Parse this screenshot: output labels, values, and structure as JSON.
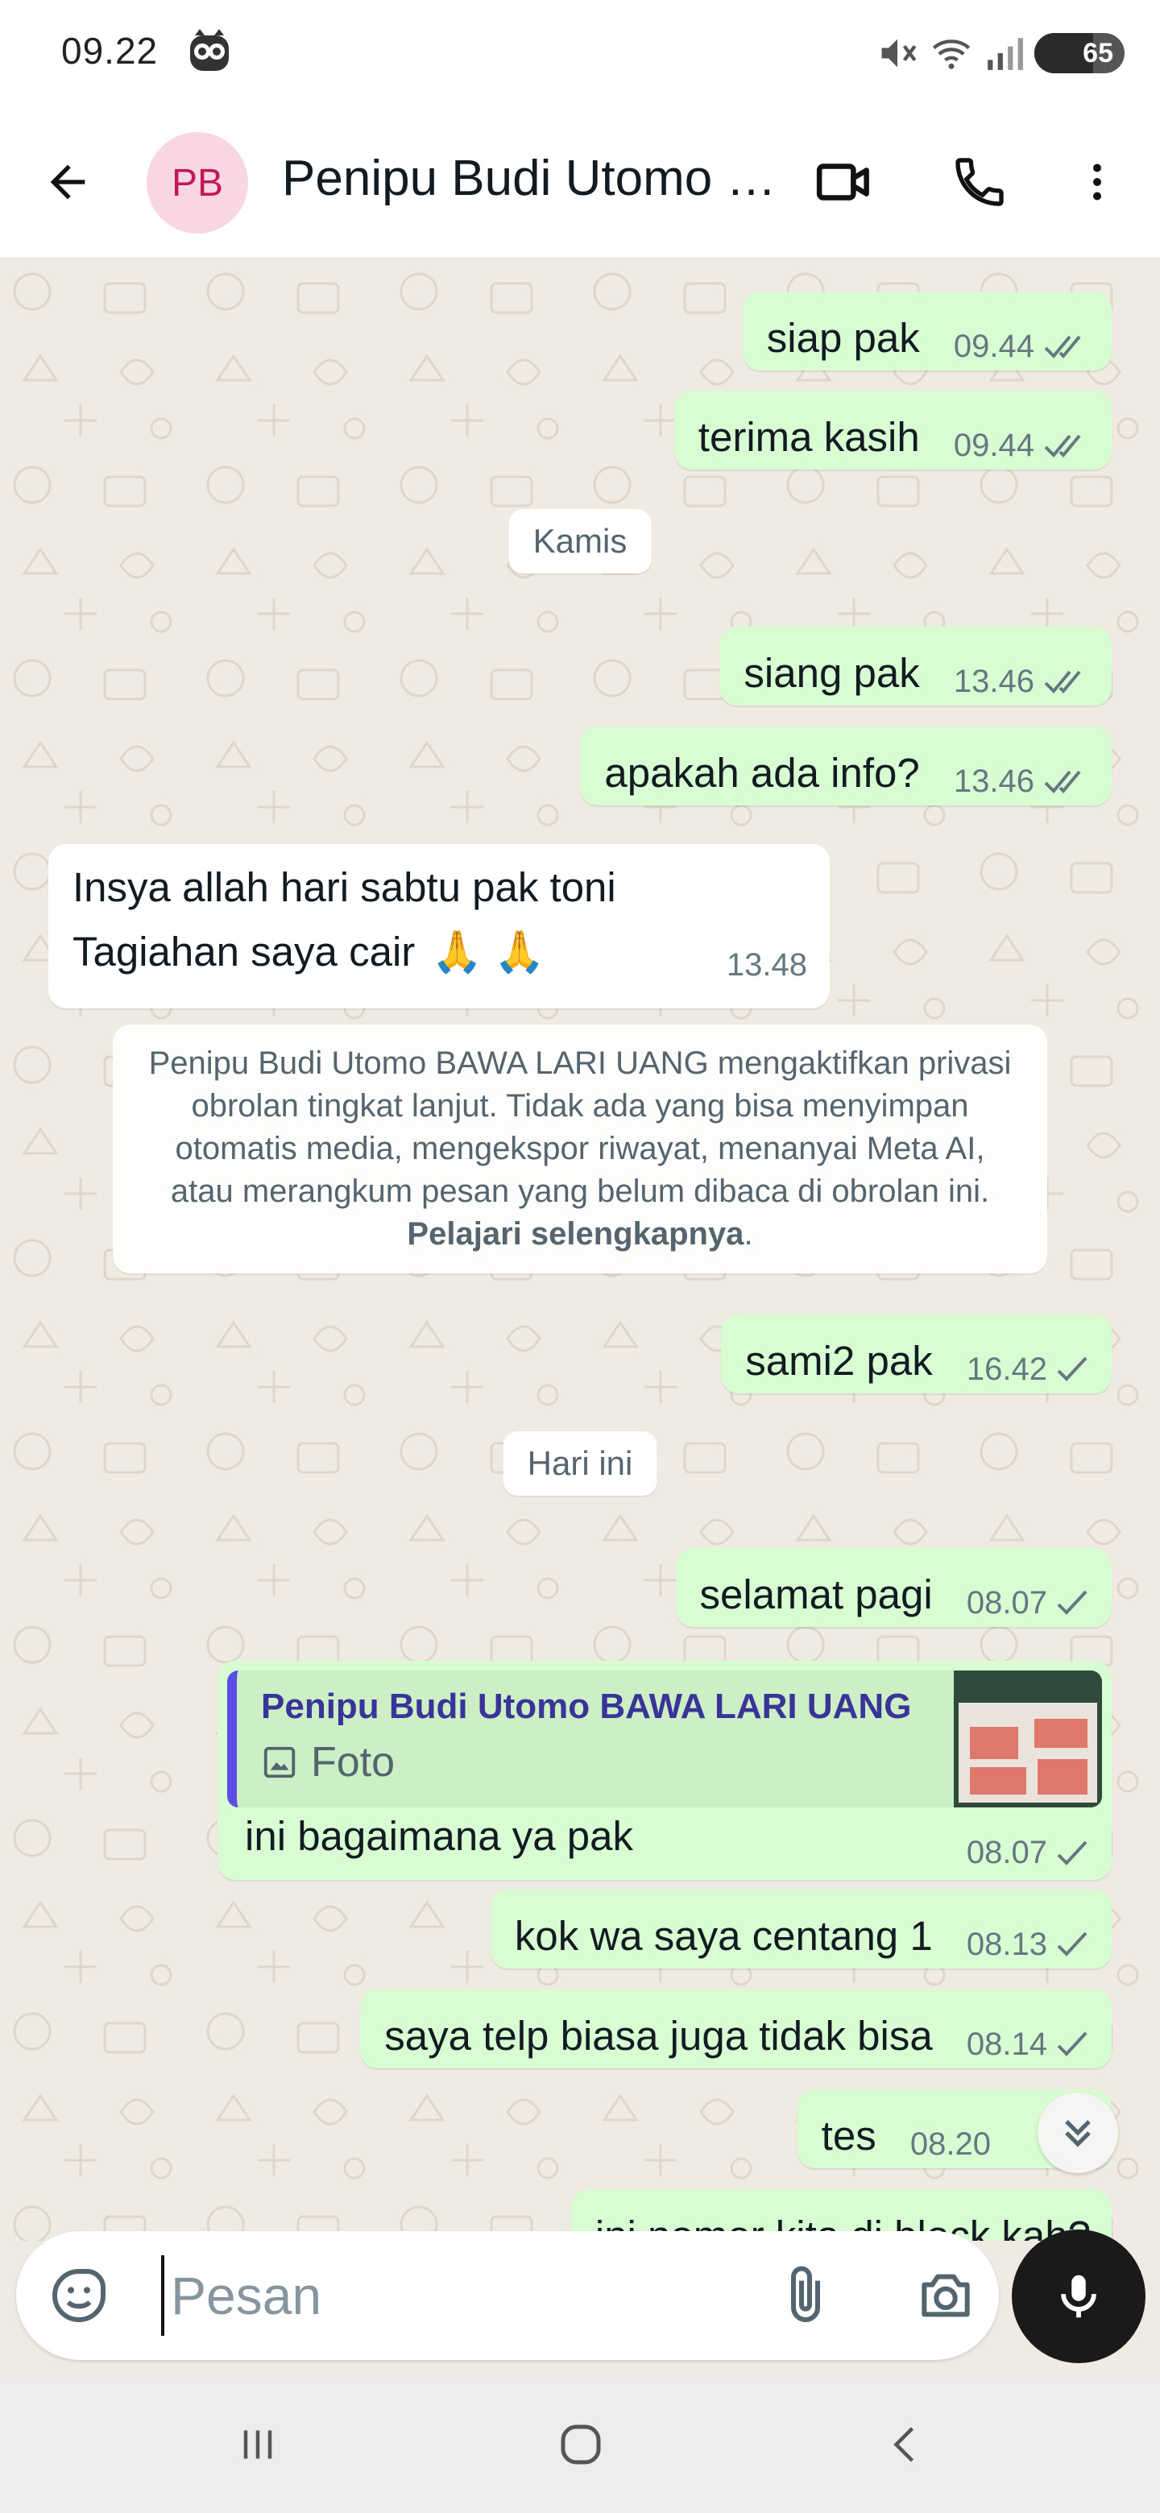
{
  "status_bar": {
    "time": "09.22",
    "battery": "65"
  },
  "header": {
    "avatar_initials": "PB",
    "contact_name": "Penipu Budi Utomo BAWA LARI UANG",
    "icons": [
      "back-arrow-icon",
      "video-call-icon",
      "phone-icon",
      "more-vert-icon"
    ]
  },
  "messages": [
    {
      "dir": "out",
      "text": "siap pak",
      "time": "09.44",
      "status": "read"
    },
    {
      "dir": "out",
      "text": "terima kasih",
      "time": "09.44",
      "status": "read"
    },
    {
      "type": "date",
      "text": "Kamis"
    },
    {
      "dir": "out",
      "text": "siang pak",
      "time": "13.46",
      "status": "read"
    },
    {
      "dir": "out",
      "text": "apakah ada info?",
      "time": "13.46",
      "status": "read"
    },
    {
      "dir": "in",
      "line1": "Insya allah hari sabtu pak toni",
      "line2": "Tagiahan saya cair",
      "emoji": "🙏 🙏",
      "time": "13.48"
    },
    {
      "type": "system",
      "text": "Penipu Budi Utomo BAWA LARI UANG mengaktifkan privasi obrolan tingkat lanjut. Tidak ada yang bisa menyimpan otomatis media, mengekspor riwayat, menanyai Meta AI, atau merangkum pesan yang belum dibaca di obrolan ini.",
      "link": "Pelajari selengkapnya"
    },
    {
      "dir": "out",
      "text": "sami2 pak",
      "time": "16.42",
      "status": "sent"
    },
    {
      "type": "date",
      "text": "Hari ini"
    },
    {
      "dir": "out",
      "text": "selamat pagi",
      "time": "08.07",
      "status": "sent"
    },
    {
      "dir": "out",
      "quote_name": "Penipu Budi Utomo BAWA LARI UANG",
      "quote_type": "Foto",
      "text": "ini bagaimana ya pak",
      "time": "08.07",
      "status": "sent"
    },
    {
      "dir": "out",
      "text": "kok wa saya centang 1",
      "time": "08.13",
      "status": "sent"
    },
    {
      "dir": "out",
      "text": "saya telp biasa juga tidak bisa",
      "time": "08.14",
      "status": "sent"
    },
    {
      "dir": "out",
      "text": "tes",
      "time": "08.20",
      "status": "sent"
    },
    {
      "dir": "out",
      "text": "ini nomor kita di block kah?",
      "partial": true
    }
  ],
  "composer": {
    "placeholder": "Pesan"
  },
  "colors": {
    "outgoing_bubble": "#d9fdd3",
    "incoming_bubble": "#ffffff",
    "chat_background": "#efeae2",
    "quote_bar": "#5b4ee6",
    "avatar_bg": "#f8d7e3",
    "avatar_text": "#c2185b"
  }
}
